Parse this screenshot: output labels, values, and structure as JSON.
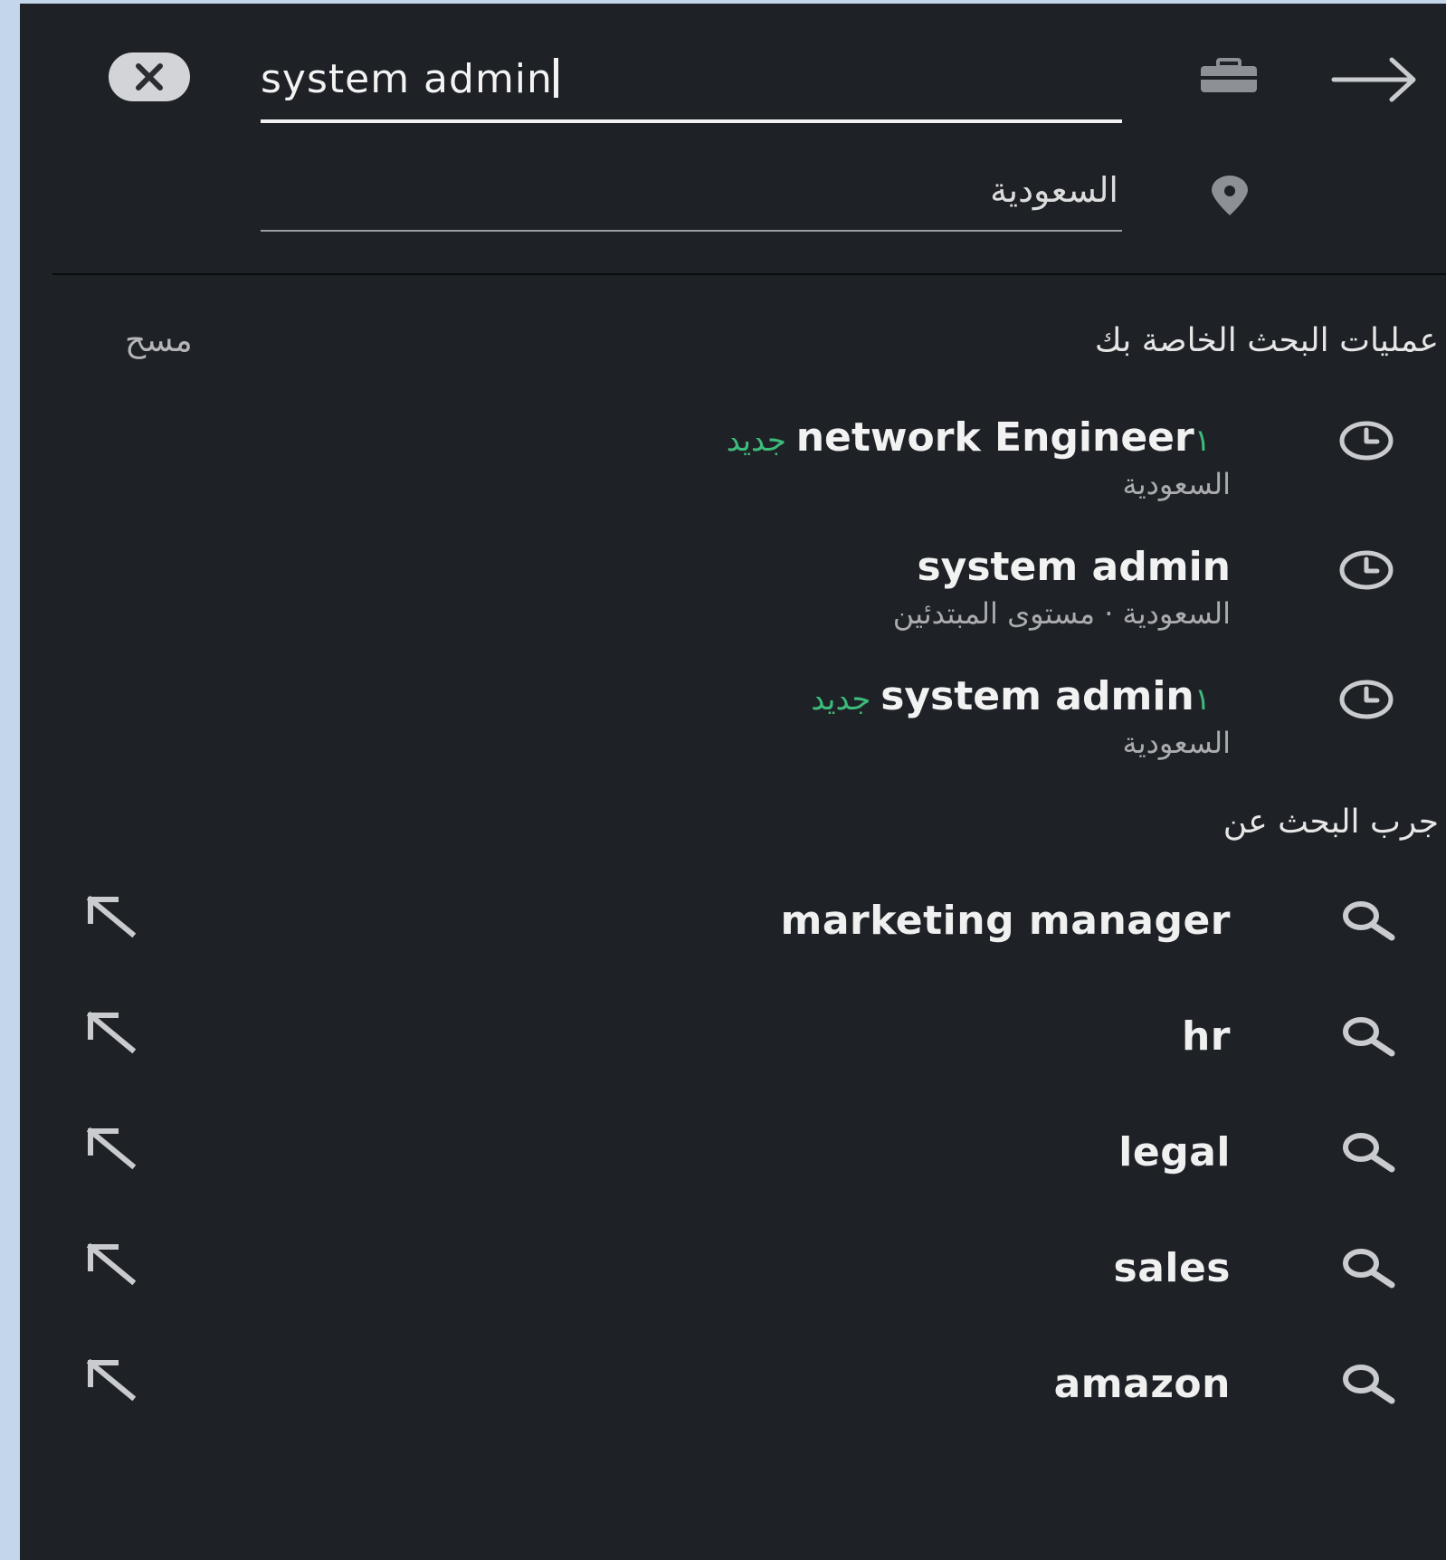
{
  "search": {
    "query": "system admin",
    "location": "السعودية",
    "clear_icon": "close-icon",
    "job_icon": "briefcase-icon",
    "location_icon": "location-pin-icon",
    "submit_icon": "arrow-right-icon"
  },
  "recent": {
    "heading": "عمليات البحث الخاصة بك",
    "clear_label": "مسح",
    "items": [
      {
        "title": "network Engineer",
        "badge": "١ جديد",
        "subtitle": "السعودية"
      },
      {
        "title": "system admin",
        "badge": "",
        "subtitle": "السعودية · مستوى المبتدئين"
      },
      {
        "title": "system admin",
        "badge": "١ جديد",
        "subtitle": "السعودية"
      }
    ]
  },
  "suggestions": {
    "heading": "جرب البحث عن",
    "items": [
      {
        "label": "marketing manager"
      },
      {
        "label": "hr"
      },
      {
        "label": "legal"
      },
      {
        "label": "sales"
      },
      {
        "label": "amazon"
      }
    ]
  },
  "colors": {
    "background": "#1e2126",
    "badge_green": "#3dbb7a",
    "text_primary": "#f2f2f2",
    "text_secondary": "#a9abae"
  }
}
